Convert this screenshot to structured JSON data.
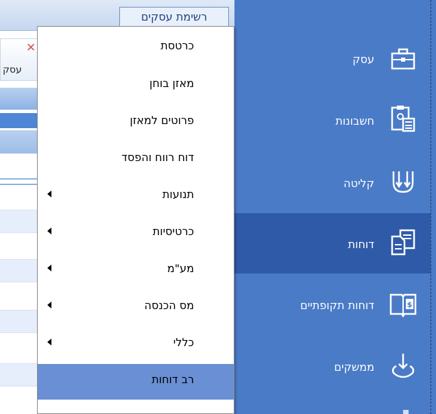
{
  "background": {
    "top_tab_label": "רשימת עסקים",
    "sub_tab_label": "עסק"
  },
  "menu": {
    "items": [
      {
        "label": "כרטסת",
        "submenu": false,
        "active": false
      },
      {
        "label": "מאזן בוחן",
        "submenu": false,
        "active": false
      },
      {
        "label": "פרוטים למאזן",
        "submenu": false,
        "active": false
      },
      {
        "label": "דוח רווח והפסד",
        "submenu": false,
        "active": false
      },
      {
        "label": "תנועות",
        "submenu": true,
        "active": false
      },
      {
        "label": "כרטיסיות",
        "submenu": true,
        "active": false
      },
      {
        "label": "מע\"מ",
        "submenu": true,
        "active": false
      },
      {
        "label": "מס הכנסה",
        "submenu": true,
        "active": false
      },
      {
        "label": "כללי",
        "submenu": true,
        "active": false
      },
      {
        "label": "רב דוחות",
        "submenu": false,
        "active": true
      }
    ]
  },
  "sidebar": {
    "items": [
      {
        "label": "עסק",
        "icon": "briefcase-icon",
        "active": false
      },
      {
        "label": "חשבונות",
        "icon": "clipboard-calculator-icon",
        "active": false
      },
      {
        "label": "קליטה",
        "icon": "import-arrows-icon",
        "active": false
      },
      {
        "label": "דוחות",
        "icon": "reports-documents-icon",
        "active": true
      },
      {
        "label": "דוחות תקופתיים",
        "icon": "periodic-reports-book-icon",
        "active": false
      },
      {
        "label": "ממשקים",
        "icon": "interface-download-icon",
        "active": false
      }
    ]
  },
  "colors": {
    "sidebar_bg": "#4a7bc7",
    "sidebar_active": "#2f5aa8",
    "menu_highlight": "#6a8fd4"
  }
}
